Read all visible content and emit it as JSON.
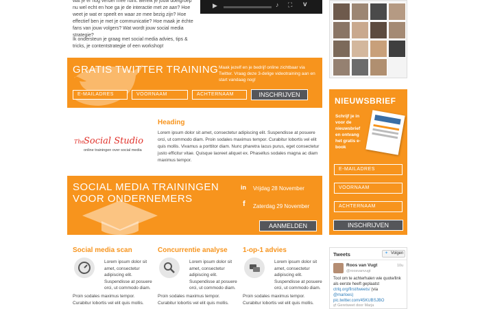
{
  "intro": {
    "paragraph1": "wat je er nog verder mee ruint. Bereik je jouw doelgroep nu wel echt en hoe ga je de interactie met ze aan? Hoe weet je wat er speelt en waar ze mee bezig zijn? Hoe effectief ben je met je communicatie? Hoe maak je échte fans van jouw volgers? Wat wordt jouw social media strategie?",
    "paragraph2": "Ik ondersteun je graag met social media advies, tips & tricks, je contentstrategie of een workshop!"
  },
  "twitter_training": {
    "title": "GRATIS TWITTER TRAINING",
    "description": "Maak jezelf en je bedrijf online zichtbaar via Twitter. Vraag deze 3-delige videotraining aan en start vandaag nog!",
    "email_placeholder": "E-MAILADRES",
    "firstname_placeholder": "VOORNAAM",
    "lastname_placeholder": "ACHTERNAAM",
    "submit_label": "INSCHRIJVEN"
  },
  "social_studio": {
    "logo_text_the": "The",
    "logo_text_main": "Social Studio",
    "logo_tagline": "online trainingen over social media",
    "heading": "Heading",
    "body": "Lorem ipsum dolor sit amet, consectetur adipiscing elit. Suspendisse at posuere orci, ut commodo diam. Proin sodales maximus tempor. Curabitur lobortis vel elit quis mollis. Vivamus a porttitor diam. Nunc pharetra lacus purus, eget consectetur justo efficitur vitae. Quisque laoreet aliquet ex. Phasellus sodales magna ac diam maximus tempor."
  },
  "trainingen": {
    "title_line1": "SOCIAL MEDIA TRAININGEN",
    "title_line2": "VOOR ONDERNEMERS",
    "date1": "Vrijdag 28 November",
    "date2": "Zaterdag 29 November",
    "button_label": "AANMELDEN"
  },
  "features": [
    {
      "title": "Social media scan",
      "text": "Lorem ipsum dolor sit amet, consectetur adipiscing elit. Suspendisse at posuere orci, ut commodo diam.",
      "more": "Proin sodales maximus tempor. Curabitur lobortis vel elit quis mollis."
    },
    {
      "title": "Concurrentie analyse",
      "text": "Lorem ipsum dolor sit amet, consectetur adipiscing elit. Suspendisse at posuere orci, ut commodo diam.",
      "more": "Proin sodales maximus tempor. Curabitur lobortis vel elit quis mollis."
    },
    {
      "title": "1-op-1 advies",
      "text": "Lorem ipsum dolor sit amet, consectetur adipiscing elit. Suspendisse at posuere orci, ut commodo diam.",
      "more": "Proin sodales maximus tempor. Curabitur lobortis vel elit quis mollis."
    }
  ],
  "newsletter": {
    "title": "NIEUWSBRIEF",
    "description": "Schrijf je in voor de nieuwsbrief en ontvang het gratis e-book",
    "email_placeholder": "E-MAILADRES",
    "firstname_placeholder": "VOORNAAM",
    "lastname_placeholder": "ACHTERNAAM",
    "submit_label": "INSCHRIJVEN"
  },
  "tweets": {
    "header": "Tweets",
    "follow_label": "Volgen",
    "tweet": {
      "name": "Roos van Vugt",
      "handle": "@roosvanvugt",
      "time": "10u",
      "text": "Tool om te achterhalen wie quote/link als eerste heeft geplaatst",
      "link1": "ctrlq.org/first/tweets/",
      "via": "(via",
      "mention": "@marloes)",
      "pic_link": "pic.twitter.com/45KUBSJBO",
      "retweet": "Geretweet door Marja"
    }
  },
  "colors": {
    "accent": "#f7941d",
    "dark_button": "#55565a"
  }
}
